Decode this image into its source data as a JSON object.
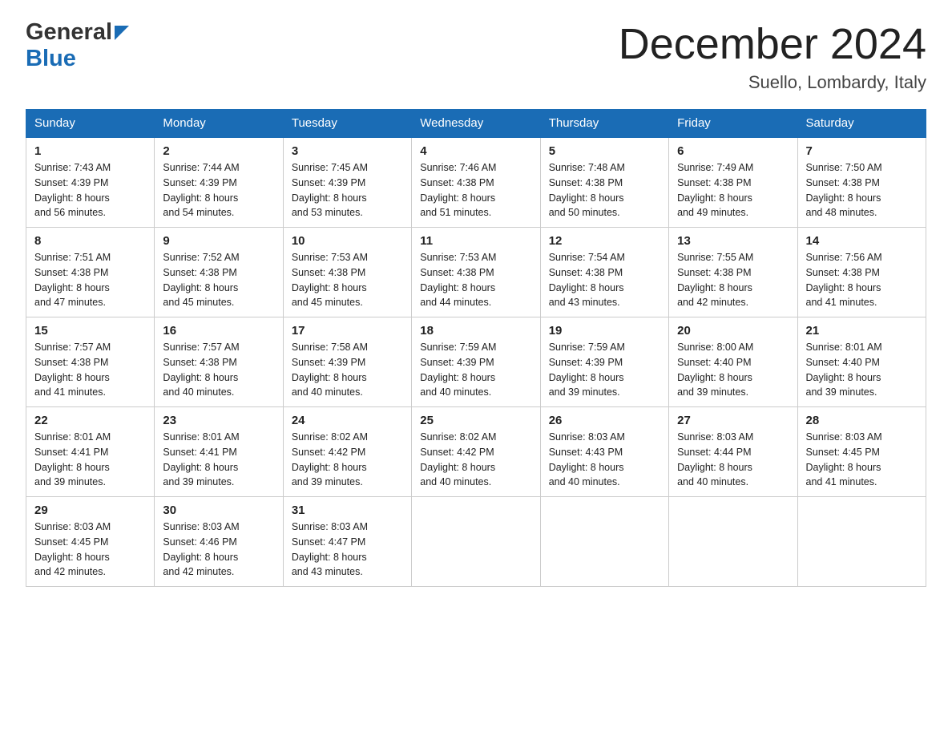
{
  "header": {
    "logo_general": "General",
    "logo_blue": "Blue",
    "month_title": "December 2024",
    "location": "Suello, Lombardy, Italy"
  },
  "days_of_week": [
    "Sunday",
    "Monday",
    "Tuesday",
    "Wednesday",
    "Thursday",
    "Friday",
    "Saturday"
  ],
  "weeks": [
    [
      {
        "day": "1",
        "sunrise": "7:43 AM",
        "sunset": "4:39 PM",
        "daylight": "8 hours and 56 minutes."
      },
      {
        "day": "2",
        "sunrise": "7:44 AM",
        "sunset": "4:39 PM",
        "daylight": "8 hours and 54 minutes."
      },
      {
        "day": "3",
        "sunrise": "7:45 AM",
        "sunset": "4:39 PM",
        "daylight": "8 hours and 53 minutes."
      },
      {
        "day": "4",
        "sunrise": "7:46 AM",
        "sunset": "4:38 PM",
        "daylight": "8 hours and 51 minutes."
      },
      {
        "day": "5",
        "sunrise": "7:48 AM",
        "sunset": "4:38 PM",
        "daylight": "8 hours and 50 minutes."
      },
      {
        "day": "6",
        "sunrise": "7:49 AM",
        "sunset": "4:38 PM",
        "daylight": "8 hours and 49 minutes."
      },
      {
        "day": "7",
        "sunrise": "7:50 AM",
        "sunset": "4:38 PM",
        "daylight": "8 hours and 48 minutes."
      }
    ],
    [
      {
        "day": "8",
        "sunrise": "7:51 AM",
        "sunset": "4:38 PM",
        "daylight": "8 hours and 47 minutes."
      },
      {
        "day": "9",
        "sunrise": "7:52 AM",
        "sunset": "4:38 PM",
        "daylight": "8 hours and 45 minutes."
      },
      {
        "day": "10",
        "sunrise": "7:53 AM",
        "sunset": "4:38 PM",
        "daylight": "8 hours and 45 minutes."
      },
      {
        "day": "11",
        "sunrise": "7:53 AM",
        "sunset": "4:38 PM",
        "daylight": "8 hours and 44 minutes."
      },
      {
        "day": "12",
        "sunrise": "7:54 AM",
        "sunset": "4:38 PM",
        "daylight": "8 hours and 43 minutes."
      },
      {
        "day": "13",
        "sunrise": "7:55 AM",
        "sunset": "4:38 PM",
        "daylight": "8 hours and 42 minutes."
      },
      {
        "day": "14",
        "sunrise": "7:56 AM",
        "sunset": "4:38 PM",
        "daylight": "8 hours and 41 minutes."
      }
    ],
    [
      {
        "day": "15",
        "sunrise": "7:57 AM",
        "sunset": "4:38 PM",
        "daylight": "8 hours and 41 minutes."
      },
      {
        "day": "16",
        "sunrise": "7:57 AM",
        "sunset": "4:38 PM",
        "daylight": "8 hours and 40 minutes."
      },
      {
        "day": "17",
        "sunrise": "7:58 AM",
        "sunset": "4:39 PM",
        "daylight": "8 hours and 40 minutes."
      },
      {
        "day": "18",
        "sunrise": "7:59 AM",
        "sunset": "4:39 PM",
        "daylight": "8 hours and 40 minutes."
      },
      {
        "day": "19",
        "sunrise": "7:59 AM",
        "sunset": "4:39 PM",
        "daylight": "8 hours and 39 minutes."
      },
      {
        "day": "20",
        "sunrise": "8:00 AM",
        "sunset": "4:40 PM",
        "daylight": "8 hours and 39 minutes."
      },
      {
        "day": "21",
        "sunrise": "8:01 AM",
        "sunset": "4:40 PM",
        "daylight": "8 hours and 39 minutes."
      }
    ],
    [
      {
        "day": "22",
        "sunrise": "8:01 AM",
        "sunset": "4:41 PM",
        "daylight": "8 hours and 39 minutes."
      },
      {
        "day": "23",
        "sunrise": "8:01 AM",
        "sunset": "4:41 PM",
        "daylight": "8 hours and 39 minutes."
      },
      {
        "day": "24",
        "sunrise": "8:02 AM",
        "sunset": "4:42 PM",
        "daylight": "8 hours and 39 minutes."
      },
      {
        "day": "25",
        "sunrise": "8:02 AM",
        "sunset": "4:42 PM",
        "daylight": "8 hours and 40 minutes."
      },
      {
        "day": "26",
        "sunrise": "8:03 AM",
        "sunset": "4:43 PM",
        "daylight": "8 hours and 40 minutes."
      },
      {
        "day": "27",
        "sunrise": "8:03 AM",
        "sunset": "4:44 PM",
        "daylight": "8 hours and 40 minutes."
      },
      {
        "day": "28",
        "sunrise": "8:03 AM",
        "sunset": "4:45 PM",
        "daylight": "8 hours and 41 minutes."
      }
    ],
    [
      {
        "day": "29",
        "sunrise": "8:03 AM",
        "sunset": "4:45 PM",
        "daylight": "8 hours and 42 minutes."
      },
      {
        "day": "30",
        "sunrise": "8:03 AM",
        "sunset": "4:46 PM",
        "daylight": "8 hours and 42 minutes."
      },
      {
        "day": "31",
        "sunrise": "8:03 AM",
        "sunset": "4:47 PM",
        "daylight": "8 hours and 43 minutes."
      },
      null,
      null,
      null,
      null
    ]
  ],
  "labels": {
    "sunrise": "Sunrise:",
    "sunset": "Sunset:",
    "daylight": "Daylight:"
  }
}
